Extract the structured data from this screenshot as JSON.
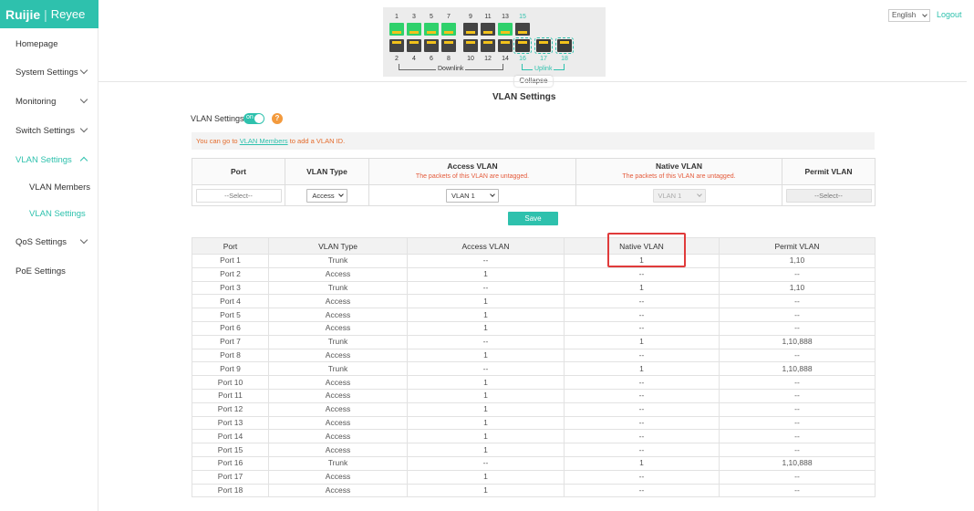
{
  "brand": {
    "name1": "Ruijie",
    "name2": "Reyee"
  },
  "header": {
    "language": "English",
    "logout": "Logout"
  },
  "sidebar": {
    "items": [
      {
        "label": "Homepage"
      },
      {
        "label": "System Settings"
      },
      {
        "label": "Monitoring"
      },
      {
        "label": "Switch Settings"
      },
      {
        "label": "VLAN Settings"
      },
      {
        "label": "VLAN Members"
      },
      {
        "label": "VLAN Settings"
      },
      {
        "label": "QoS Settings"
      },
      {
        "label": "PoE Settings"
      }
    ]
  },
  "switch_panel": {
    "top_labels": [
      "1",
      "3",
      "5",
      "7",
      "9",
      "11",
      "13",
      "15"
    ],
    "bottom_labels": [
      "2",
      "4",
      "6",
      "8",
      "10",
      "12",
      "14",
      "16",
      "17",
      "18"
    ],
    "downlink": "Downlink",
    "uplink": "Uplink",
    "collapse": "Collapse",
    "colors": {
      "up": "#2fd16b",
      "down": "#444444",
      "accent": "#2ec1ad"
    }
  },
  "page": {
    "title": "VLAN Settings",
    "vlan_toggle_label": "VLAN Settings",
    "vlan_toggle_state": "on",
    "notice_pre": "You can go to ",
    "notice_link": "VLAN Members",
    "notice_post": " to add a VLAN ID.",
    "save": "Save"
  },
  "form": {
    "headers": {
      "port": "Port",
      "vlan_type": "VLAN Type",
      "access_vlan": "Access VLAN",
      "access_note": "The packets of this VLAN are untagged.",
      "native_vlan": "Native VLAN",
      "native_note": "The packets of this VLAN are untagged.",
      "permit_vlan": "Permit VLAN"
    },
    "port_value": "--Select--",
    "vlan_type_value": "Access",
    "access_vlan_value": "VLAN 1",
    "native_vlan_value": "VLAN 1",
    "permit_vlan_value": "--Select--"
  },
  "table": {
    "headers": [
      "Port",
      "VLAN Type",
      "Access VLAN",
      "Native VLAN",
      "Permit VLAN"
    ],
    "rows": [
      [
        "Port 1",
        "Trunk",
        "--",
        "1",
        "1,10"
      ],
      [
        "Port 2",
        "Access",
        "1",
        "--",
        "--"
      ],
      [
        "Port 3",
        "Trunk",
        "--",
        "1",
        "1,10"
      ],
      [
        "Port 4",
        "Access",
        "1",
        "--",
        "--"
      ],
      [
        "Port 5",
        "Access",
        "1",
        "--",
        "--"
      ],
      [
        "Port 6",
        "Access",
        "1",
        "--",
        "--"
      ],
      [
        "Port 7",
        "Trunk",
        "--",
        "1",
        "1,10,888"
      ],
      [
        "Port 8",
        "Access",
        "1",
        "--",
        "--"
      ],
      [
        "Port 9",
        "Trunk",
        "--",
        "1",
        "1,10,888"
      ],
      [
        "Port 10",
        "Access",
        "1",
        "--",
        "--"
      ],
      [
        "Port 11",
        "Access",
        "1",
        "--",
        "--"
      ],
      [
        "Port 12",
        "Access",
        "1",
        "--",
        "--"
      ],
      [
        "Port 13",
        "Access",
        "1",
        "--",
        "--"
      ],
      [
        "Port 14",
        "Access",
        "1",
        "--",
        "--"
      ],
      [
        "Port 15",
        "Access",
        "1",
        "--",
        "--"
      ],
      [
        "Port 16",
        "Trunk",
        "--",
        "1",
        "1,10,888"
      ],
      [
        "Port 17",
        "Access",
        "1",
        "--",
        "--"
      ],
      [
        "Port 18",
        "Access",
        "1",
        "--",
        "--"
      ]
    ]
  }
}
